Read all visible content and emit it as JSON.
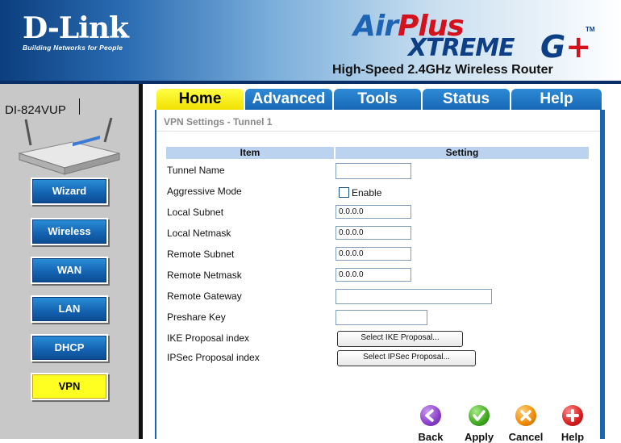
{
  "brand": {
    "logo_main": "D-Link",
    "logo_tagline": "Building Networks for People",
    "product_air": "Air",
    "product_plus": "Plus",
    "product_xtreme": "XTREME",
    "product_g": "G",
    "product_plus_sign": "+",
    "product_tm": "TM",
    "subtitle": "High-Speed 2.4GHz Wireless Router"
  },
  "sidebar": {
    "model": "DI-824VUP",
    "items": [
      {
        "label": "Wizard",
        "active": false
      },
      {
        "label": "Wireless",
        "active": false
      },
      {
        "label": "WAN",
        "active": false
      },
      {
        "label": "LAN",
        "active": false
      },
      {
        "label": "DHCP",
        "active": false
      },
      {
        "label": "VPN",
        "active": true
      }
    ]
  },
  "tabs": [
    {
      "label": "Home",
      "active": true
    },
    {
      "label": "Advanced",
      "active": false
    },
    {
      "label": "Tools",
      "active": false
    },
    {
      "label": "Status",
      "active": false
    },
    {
      "label": "Help",
      "active": false
    }
  ],
  "page": {
    "title": "VPN Settings - Tunnel 1",
    "col_item": "Item",
    "col_setting": "Setting"
  },
  "form": {
    "tunnel_name": {
      "label": "Tunnel Name",
      "value": ""
    },
    "aggressive_mode": {
      "label": "Aggressive Mode",
      "checkbox_label": "Enable",
      "checked": false
    },
    "local_subnet": {
      "label": "Local Subnet",
      "value": "0.0.0.0"
    },
    "local_netmask": {
      "label": "Local Netmask",
      "value": "0.0.0.0"
    },
    "remote_subnet": {
      "label": "Remote Subnet",
      "value": "0.0.0.0"
    },
    "remote_netmask": {
      "label": "Remote Netmask",
      "value": "0.0.0.0"
    },
    "remote_gateway": {
      "label": "Remote Gateway",
      "value": ""
    },
    "preshare_key": {
      "label": "Preshare Key",
      "value": ""
    },
    "ike_proposal": {
      "label": "IKE Proposal index",
      "button": "Select IKE Proposal..."
    },
    "ipsec_proposal": {
      "label": "IPSec Proposal index",
      "button": "Select IPSec Proposal..."
    }
  },
  "actions": {
    "back": "Back",
    "apply": "Apply",
    "cancel": "Cancel",
    "help": "Help"
  },
  "colors": {
    "nav_blue": "#1565b3",
    "active_yellow": "#ffff22",
    "back_purple": "#8a3fc8",
    "apply_green": "#3fa820",
    "cancel_orange": "#f08a00",
    "help_red": "#d81e1e"
  }
}
